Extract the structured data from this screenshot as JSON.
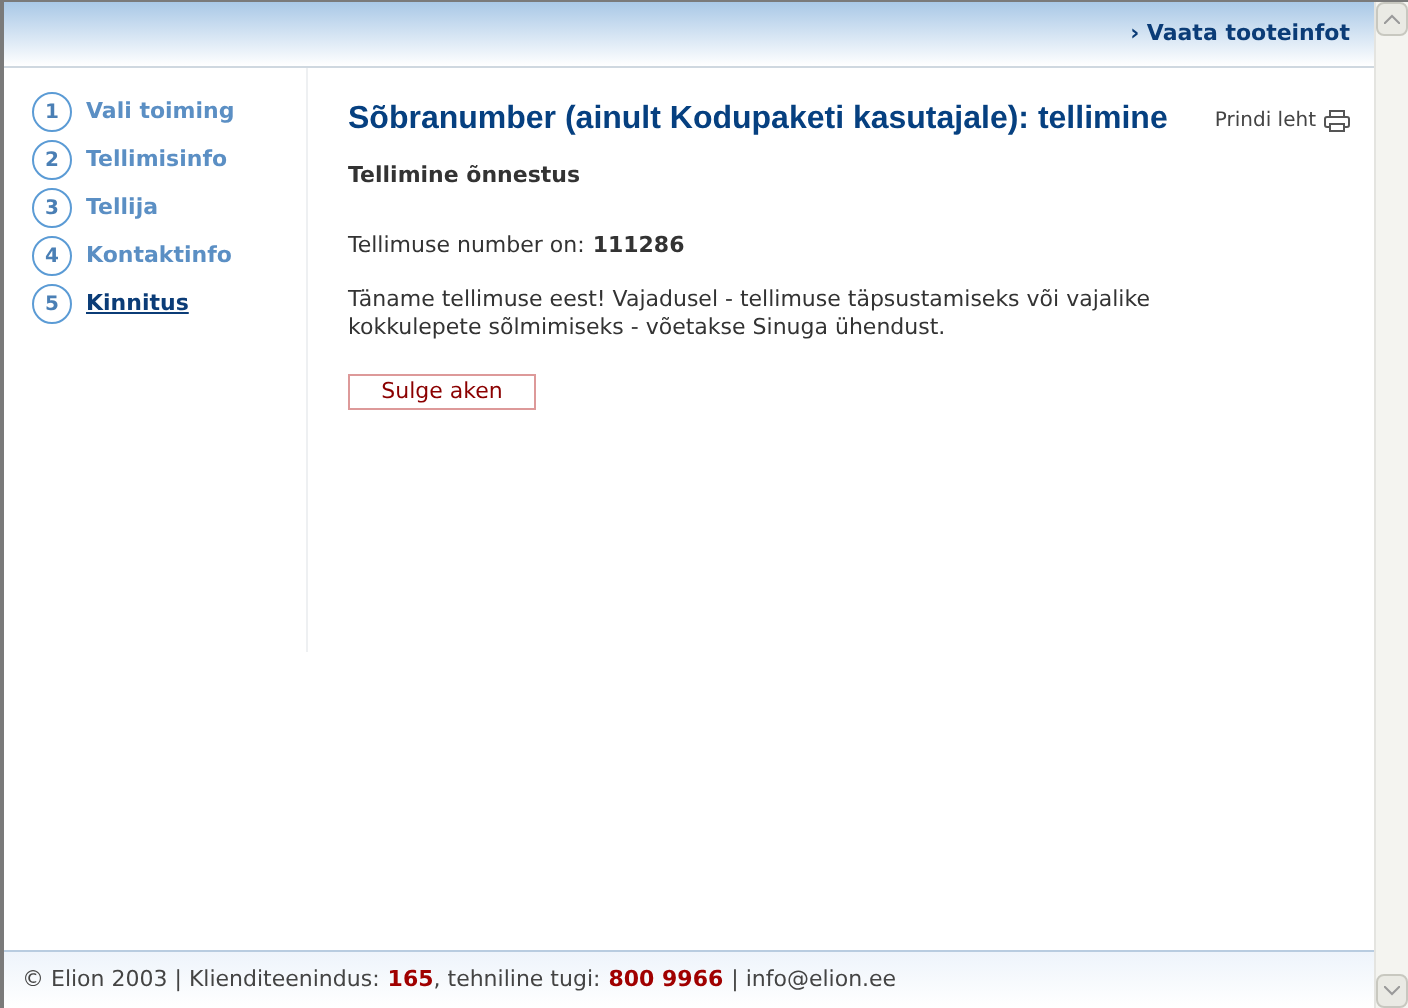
{
  "header": {
    "link": "› Vaata tooteinfot"
  },
  "steps": [
    {
      "number": "1",
      "label": "Vali toiming",
      "selected": false
    },
    {
      "number": "2",
      "label": "Tellimisinfo",
      "selected": false
    },
    {
      "number": "3",
      "label": "Tellija",
      "selected": false
    },
    {
      "number": "4",
      "label": "Kontaktinfo",
      "selected": false
    },
    {
      "number": "5",
      "label": "Kinnitus",
      "selected": true
    }
  ],
  "main": {
    "title": "Sõbranumber (ainult Kodupaketi kasutajale): tellimine",
    "print_link": "Prindi leht",
    "subtitle": "Tellimine õnnestus",
    "order_label": "Tellimuse number on:",
    "order_number": "111286",
    "message": "Täname tellimuse eest! Vajadusel - tellimuse täpsustamiseks või vajalike kokkulepete sõlmimiseks - võetakse Sinuga ühendust.",
    "close_button": "Sulge aken"
  },
  "footer": {
    "copyright": "© Elion 2003 | Klienditeenindus:",
    "customer_phone": "165",
    "tech_label": ", tehniline tugi:",
    "tech_phone": "800 9966",
    "email": "| info@elion.ee"
  }
}
